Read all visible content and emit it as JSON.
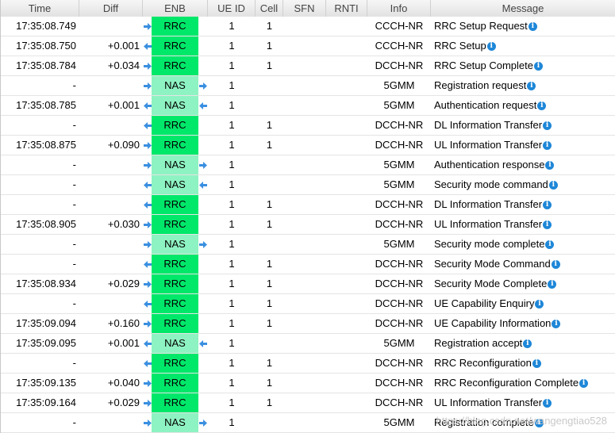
{
  "columns": [
    "Time",
    "Diff",
    "ENB",
    "UE ID",
    "Cell",
    "SFN",
    "RNTI",
    "Info",
    "Message"
  ],
  "colors": {
    "rrc": "#00e86a",
    "nas": "#8ef3c2",
    "arrow": "#3a8fe0",
    "info_icon": "#1e87d8"
  },
  "icons": {
    "incoming": "arrow-right-icon",
    "outgoing": "arrow-left-icon",
    "info": "info-icon"
  },
  "rows": [
    {
      "time": "17:35:08.749",
      "diff": "",
      "dir_in": "right",
      "proto": "RRC",
      "dir_out": "",
      "ue": "1",
      "cell": "1",
      "sfn": "",
      "rnti": "",
      "info": "CCCH-NR",
      "msg": "RRC Setup Request"
    },
    {
      "time": "17:35:08.750",
      "diff": "+0.001",
      "dir_in": "left",
      "proto": "RRC",
      "dir_out": "",
      "ue": "1",
      "cell": "1",
      "sfn": "",
      "rnti": "",
      "info": "CCCH-NR",
      "msg": "RRC Setup"
    },
    {
      "time": "17:35:08.784",
      "diff": "+0.034",
      "dir_in": "right",
      "proto": "RRC",
      "dir_out": "",
      "ue": "1",
      "cell": "1",
      "sfn": "",
      "rnti": "",
      "info": "DCCH-NR",
      "msg": "RRC Setup Complete"
    },
    {
      "time": "-",
      "diff": "",
      "dir_in": "right",
      "proto": "NAS",
      "dir_out": "right",
      "ue": "1",
      "cell": "",
      "sfn": "",
      "rnti": "",
      "info": "5GMM",
      "msg": "Registration request"
    },
    {
      "time": "17:35:08.785",
      "diff": "+0.001",
      "dir_in": "left",
      "proto": "NAS",
      "dir_out": "left",
      "ue": "1",
      "cell": "",
      "sfn": "",
      "rnti": "",
      "info": "5GMM",
      "msg": "Authentication request"
    },
    {
      "time": "-",
      "diff": "",
      "dir_in": "left",
      "proto": "RRC",
      "dir_out": "",
      "ue": "1",
      "cell": "1",
      "sfn": "",
      "rnti": "",
      "info": "DCCH-NR",
      "msg": "DL Information Transfer"
    },
    {
      "time": "17:35:08.875",
      "diff": "+0.090",
      "dir_in": "right",
      "proto": "RRC",
      "dir_out": "",
      "ue": "1",
      "cell": "1",
      "sfn": "",
      "rnti": "",
      "info": "DCCH-NR",
      "msg": "UL Information Transfer"
    },
    {
      "time": "-",
      "diff": "",
      "dir_in": "right",
      "proto": "NAS",
      "dir_out": "right",
      "ue": "1",
      "cell": "",
      "sfn": "",
      "rnti": "",
      "info": "5GMM",
      "msg": "Authentication response"
    },
    {
      "time": "-",
      "diff": "",
      "dir_in": "left",
      "proto": "NAS",
      "dir_out": "left",
      "ue": "1",
      "cell": "",
      "sfn": "",
      "rnti": "",
      "info": "5GMM",
      "msg": "Security mode command"
    },
    {
      "time": "-",
      "diff": "",
      "dir_in": "left",
      "proto": "RRC",
      "dir_out": "",
      "ue": "1",
      "cell": "1",
      "sfn": "",
      "rnti": "",
      "info": "DCCH-NR",
      "msg": "DL Information Transfer"
    },
    {
      "time": "17:35:08.905",
      "diff": "+0.030",
      "dir_in": "right",
      "proto": "RRC",
      "dir_out": "",
      "ue": "1",
      "cell": "1",
      "sfn": "",
      "rnti": "",
      "info": "DCCH-NR",
      "msg": "UL Information Transfer"
    },
    {
      "time": "-",
      "diff": "",
      "dir_in": "right",
      "proto": "NAS",
      "dir_out": "right",
      "ue": "1",
      "cell": "",
      "sfn": "",
      "rnti": "",
      "info": "5GMM",
      "msg": "Security mode complete"
    },
    {
      "time": "-",
      "diff": "",
      "dir_in": "left",
      "proto": "RRC",
      "dir_out": "",
      "ue": "1",
      "cell": "1",
      "sfn": "",
      "rnti": "",
      "info": "DCCH-NR",
      "msg": "Security Mode Command"
    },
    {
      "time": "17:35:08.934",
      "diff": "+0.029",
      "dir_in": "right",
      "proto": "RRC",
      "dir_out": "",
      "ue": "1",
      "cell": "1",
      "sfn": "",
      "rnti": "",
      "info": "DCCH-NR",
      "msg": "Security Mode Complete"
    },
    {
      "time": "-",
      "diff": "",
      "dir_in": "left",
      "proto": "RRC",
      "dir_out": "",
      "ue": "1",
      "cell": "1",
      "sfn": "",
      "rnti": "",
      "info": "DCCH-NR",
      "msg": "UE Capability Enquiry"
    },
    {
      "time": "17:35:09.094",
      "diff": "+0.160",
      "dir_in": "right",
      "proto": "RRC",
      "dir_out": "",
      "ue": "1",
      "cell": "1",
      "sfn": "",
      "rnti": "",
      "info": "DCCH-NR",
      "msg": "UE Capability Information"
    },
    {
      "time": "17:35:09.095",
      "diff": "+0.001",
      "dir_in": "left",
      "proto": "NAS",
      "dir_out": "left",
      "ue": "1",
      "cell": "",
      "sfn": "",
      "rnti": "",
      "info": "5GMM",
      "msg": "Registration accept"
    },
    {
      "time": "-",
      "diff": "",
      "dir_in": "left",
      "proto": "RRC",
      "dir_out": "",
      "ue": "1",
      "cell": "1",
      "sfn": "",
      "rnti": "",
      "info": "DCCH-NR",
      "msg": "RRC Reconfiguration"
    },
    {
      "time": "17:35:09.135",
      "diff": "+0.040",
      "dir_in": "right",
      "proto": "RRC",
      "dir_out": "",
      "ue": "1",
      "cell": "1",
      "sfn": "",
      "rnti": "",
      "info": "DCCH-NR",
      "msg": "RRC Reconfiguration Complete"
    },
    {
      "time": "17:35:09.164",
      "diff": "+0.029",
      "dir_in": "right",
      "proto": "RRC",
      "dir_out": "",
      "ue": "1",
      "cell": "1",
      "sfn": "",
      "rnti": "",
      "info": "DCCH-NR",
      "msg": "UL Information Transfer"
    },
    {
      "time": "-",
      "diff": "",
      "dir_in": "right",
      "proto": "NAS",
      "dir_out": "right",
      "ue": "1",
      "cell": "",
      "sfn": "",
      "rnti": "",
      "info": "5GMM",
      "msg": "Registration complete"
    }
  ],
  "watermark": "https://blog.csdn.net/wangengtiao528"
}
